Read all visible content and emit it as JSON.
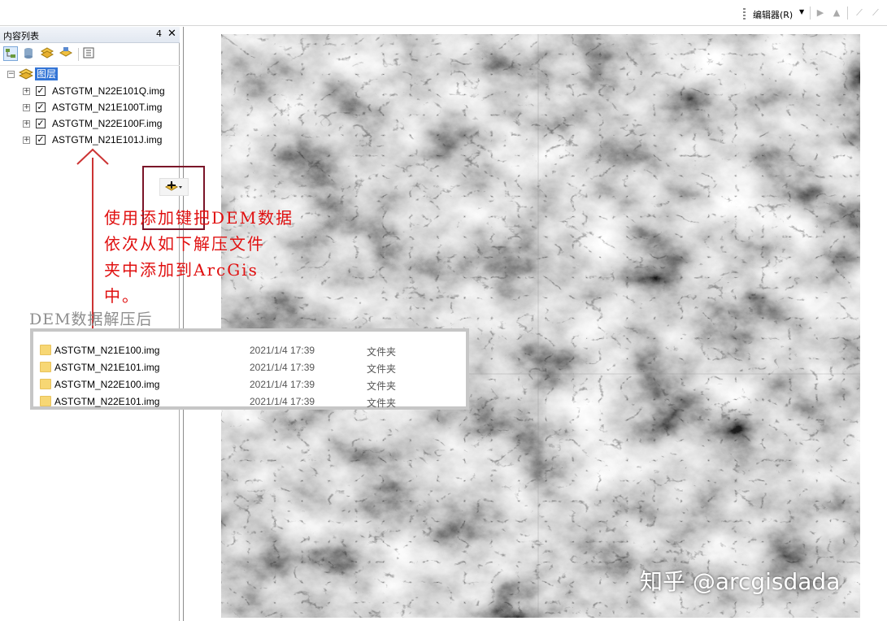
{
  "toolbar": {
    "editor_menu": "编辑器(R)"
  },
  "toc": {
    "title": "内容列表",
    "pin": "4",
    "close": "✕",
    "group": "图层",
    "layers": [
      {
        "name": "ASTGTM_N22E101Q.img",
        "checked": true
      },
      {
        "name": "ASTGTM_N21E100T.img",
        "checked": true
      },
      {
        "name": "ASTGTM_N22E100F.img",
        "checked": true
      },
      {
        "name": "ASTGTM_N21E101J.img",
        "checked": true
      }
    ]
  },
  "annotation": {
    "red_line1": "使用添加键把DEM数据",
    "red_line2": "依次从如下解压文件",
    "red_line3": "夹中添加到ArcGis",
    "red_line4": "中。",
    "gray_label": "DEM数据解压后"
  },
  "explorer": {
    "files": [
      {
        "name": "ASTGTM_N21E100.img",
        "date": "2021/1/4 17:39",
        "type": "文件夹"
      },
      {
        "name": "ASTGTM_N21E101.img",
        "date": "2021/1/4 17:39",
        "type": "文件夹"
      },
      {
        "name": "ASTGTM_N22E100.img",
        "date": "2021/1/4 17:39",
        "type": "文件夹"
      },
      {
        "name": "ASTGTM_N22E101.img",
        "date": "2021/1/4 17:39",
        "type": "文件夹"
      }
    ]
  },
  "watermark": "知乎 @arcgisdada",
  "colors": {
    "selection": "#3375d6",
    "annotation_red": "#e01010",
    "box_border": "#7a1428"
  }
}
